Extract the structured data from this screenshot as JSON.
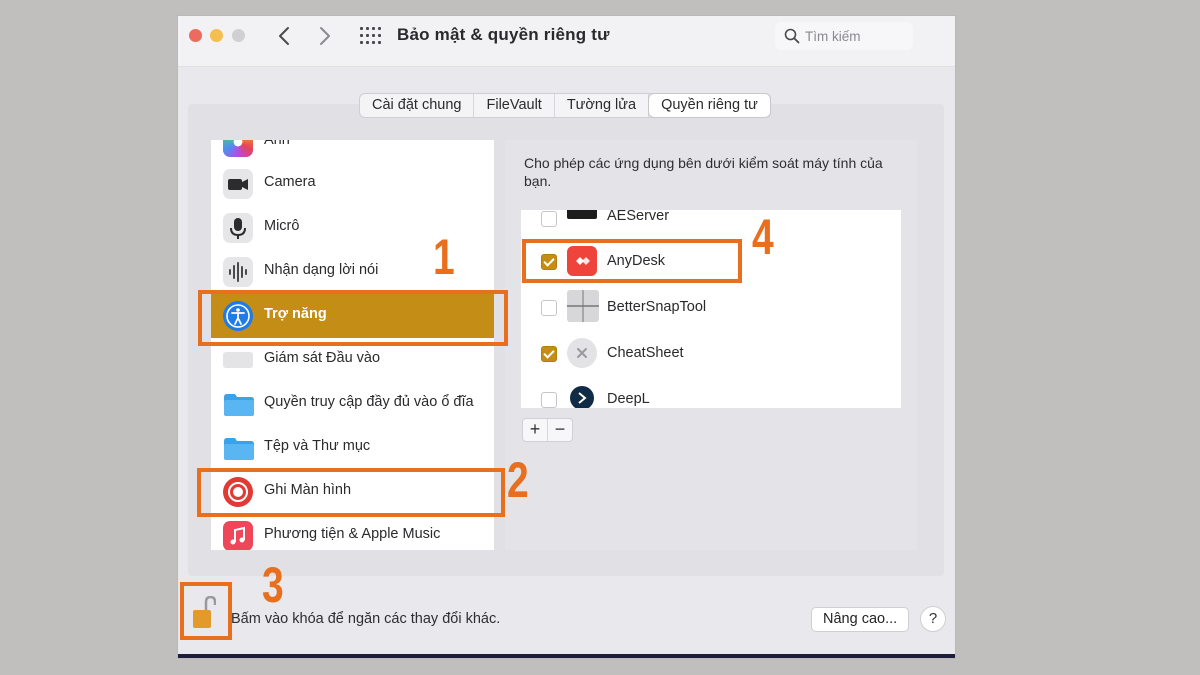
{
  "window": {
    "title": "Bảo mật & quyền riêng tư",
    "search_placeholder": "Tìm kiếm"
  },
  "tabs": [
    {
      "label": "Cài đặt chung",
      "active": false
    },
    {
      "label": "FileVault",
      "active": false
    },
    {
      "label": "Tường lửa",
      "active": false
    },
    {
      "label": "Quyền riêng tư",
      "active": true
    }
  ],
  "sidebar": {
    "items": [
      {
        "label": "Ảnh",
        "icon": "photos-icon"
      },
      {
        "label": "Camera",
        "icon": "camera-icon"
      },
      {
        "label": "Micrô",
        "icon": "microphone-icon"
      },
      {
        "label": "Nhận dạng lời nói",
        "icon": "speech-recognition-icon"
      },
      {
        "label": "Trợ năng",
        "icon": "accessibility-icon",
        "selected": true
      },
      {
        "label": "Giám sát Đầu vào",
        "icon": "keyboard-icon"
      },
      {
        "label": "Quyền truy cập đầy đủ vào ổ đĩa",
        "icon": "folder-icon"
      },
      {
        "label": "Tệp và Thư mục",
        "icon": "folder-icon"
      },
      {
        "label": "Ghi Màn hình",
        "icon": "screen-recording-icon"
      },
      {
        "label": "Phương tiện & Apple Music",
        "icon": "music-icon"
      }
    ]
  },
  "panel": {
    "description": "Cho phép các ứng dụng bên dưới kiểm soát máy tính của bạn.",
    "apps": [
      {
        "name": "AEServer",
        "checked": false
      },
      {
        "name": "AnyDesk",
        "checked": true
      },
      {
        "name": "BetterSnapTool",
        "checked": false
      },
      {
        "name": "CheatSheet",
        "checked": true
      },
      {
        "name": "DeepL",
        "checked": false
      }
    ],
    "add_label": "+",
    "remove_label": "−"
  },
  "footer": {
    "lock_text": "Bấm vào khóa để ngăn các thay đổi khác.",
    "advanced_label": "Nâng cao...",
    "help_label": "?"
  },
  "annotations": {
    "step1": "1",
    "step2": "2",
    "step3": "3",
    "step4": "4",
    "highlight_color": "#e76f1e"
  },
  "colors": {
    "selection": "#c48e16",
    "close": "#ed6a5e",
    "minimize": "#f5bf4f"
  }
}
